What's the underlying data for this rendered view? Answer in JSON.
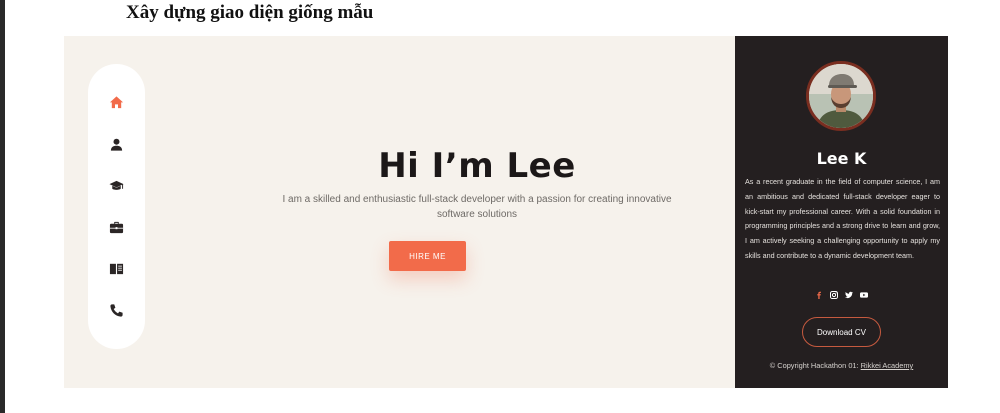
{
  "heading": "Xây dựng giao diện giống mẫu",
  "nav": {
    "items": [
      {
        "name": "home",
        "icon": "home-icon",
        "active": true
      },
      {
        "name": "about",
        "icon": "user-icon",
        "active": false
      },
      {
        "name": "education",
        "icon": "graduation-cap-icon",
        "active": false
      },
      {
        "name": "experience",
        "icon": "briefcase-icon",
        "active": false
      },
      {
        "name": "portfolio",
        "icon": "book-icon",
        "active": false
      },
      {
        "name": "contact",
        "icon": "phone-icon",
        "active": false
      }
    ]
  },
  "hero": {
    "title": "Hi I’m Lee",
    "subtitle": "I am a skilled and enthusiastic full-stack developer with a passion for creating innovative software solutions",
    "button_label": "HIRE ME"
  },
  "profile": {
    "name": "Lee K",
    "bio": "As a recent graduate in the field of computer science, I am an ambitious and dedicated full-stack developer eager to kick-start my professional career. With a solid foundation in programming principles and a strong drive to learn and grow, I am actively seeking a challenging opportunity to apply my skills and contribute to a dynamic development team.",
    "socials": [
      {
        "name": "facebook",
        "icon": "facebook-icon"
      },
      {
        "name": "instagram",
        "icon": "instagram-icon"
      },
      {
        "name": "twitter",
        "icon": "twitter-icon"
      },
      {
        "name": "youtube",
        "icon": "youtube-icon"
      }
    ],
    "download_label": "Download CV",
    "copyright_prefix": "© Copyright Hackathon 01:",
    "copyright_link": "Rikkei Academy"
  },
  "colors": {
    "accent": "#f26b4a",
    "nav_icon": "#2b2626",
    "main_bg": "#f6f2ec",
    "sidebar_bg": "#241f20",
    "avatar_ring": "#7a2e20"
  }
}
